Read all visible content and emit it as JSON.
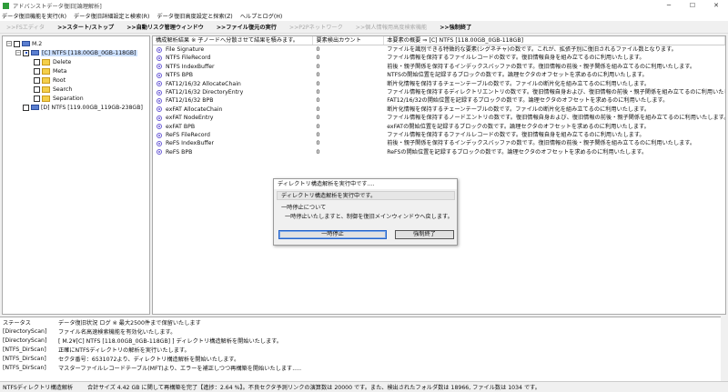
{
  "window": {
    "title": "アドバンストデータ復旧[論理解析]",
    "ctrl_min": "─",
    "ctrl_max": "☐",
    "ctrl_close": "✕"
  },
  "menu": [
    "データ復旧機能を実行(R)",
    "データ復旧詳細設定と検索(R)",
    "データ復旧高度設定と探索(Z)",
    "ヘルプとログ(H)"
  ],
  "toolbar": {
    "fs_editor": ">>FSエディタ",
    "start_stop": ">>スタート/ストップ",
    "auto_window": ">>自動リスク管理ウィンドウ",
    "file_restore": ">>ファイル復元の実行",
    "p2p": ">>P2Pネットワーク",
    "personal_info": ">>個人情報用高度検索機能",
    "force_quit": ">>強制終了"
  },
  "tree": {
    "root": "M.2",
    "drive_c": "[C] NTFS [118.00GB_0GB-118GB]",
    "folders": [
      "Delete",
      "Meta",
      "Root",
      "Search",
      "Separation"
    ],
    "drive_d": "[D] NTFS [119.00GB_119GB-238GB]",
    "expand_minus": "−"
  },
  "list": {
    "headers": [
      "構成解析結果 ※ 子ノードへ分散させて結果を積みます。",
      "要素検出カウント",
      "本要素の概要 ⇒ [C] NTFS [118.00GB_0GB-118GB]"
    ],
    "rows": [
      {
        "name": "File Signature",
        "count": "0",
        "desc": "ファイルを識別できる特徴的な要素(シグネチャ)の数です。これが、拡張子別に復旧されるファイル数となります。"
      },
      {
        "name": "NTFS FileRecord",
        "count": "0",
        "desc": "ファイル情報を保持するファイルレコードの数です。復旧情報自身を組み立てるのに利用いたします。"
      },
      {
        "name": "NTFS IndexBuffer",
        "count": "0",
        "desc": "前後・親子関係を保持するインデックスバッファの数です。復旧情報の前後・親子関係を組み立てるのに利用いたします。"
      },
      {
        "name": "NTFS BPB",
        "count": "0",
        "desc": "NTFSの開始位置を記録するブロックの数です。論理セクタのオフセットを求めるのに利用いたします。"
      },
      {
        "name": "FAT12/16/32 AllocateChain",
        "count": "0",
        "desc": "断片化情報を保持するチェーンテーブルの数です。ファイルの断片化を組み立てるのに利用いたします。"
      },
      {
        "name": "FAT12/16/32 DirectoryEntry",
        "count": "0",
        "desc": "ファイル情報を保持するディレクトリエントリの数です。復旧情報自身および、復旧情報の前後・親子関係を組み立てるのに利用いたします。"
      },
      {
        "name": "FAT12/16/32 BPB",
        "count": "0",
        "desc": "FAT12/16/32の開始位置を記録するブロックの数です。論理セクタのオフセットを求めるのに利用いたします。"
      },
      {
        "name": "exFAT AllocateChain",
        "count": "0",
        "desc": "断片化情報を保持するチェーンテーブルの数です。ファイルの断片化を組み立てるのに利用いたします。"
      },
      {
        "name": "exFAT NodeEntry",
        "count": "0",
        "desc": "ファイル情報を保持するノードエントリの数です。復旧情報自身および、復旧情報の前後・親子関係を組み立てるのに利用いたします。"
      },
      {
        "name": "exFAT BPB",
        "count": "0",
        "desc": "exFATの開始位置を記録するブロックの数です。論理セクタのオフセットを求めるのに利用いたします。"
      },
      {
        "name": "ReFS FileRecord",
        "count": "0",
        "desc": "ファイル情報を保持するファイルレコードの数です。復旧情報自身を組み立てるのに利用いたします。"
      },
      {
        "name": "ReFS IndexBuffer",
        "count": "0",
        "desc": "前後・親子関係を保持するインデックスバッファの数です。復旧情報の前後・親子関係を組み立てるのに利用いたします。"
      },
      {
        "name": "ReFS BPB",
        "count": "0",
        "desc": "ReFSの開始位置を記録するブロックの数です。論理セクタのオフセットを求めるのに利用いたします。"
      }
    ]
  },
  "dialog": {
    "title": "ディレクトリ構造解析を実行中です....",
    "message": "ディレクトリ構造解析を実行中です。",
    "line1": "一時停止について",
    "line2": "一時停止いたしますと、制御を復旧メインウィンドウへ戻します。",
    "pause_button": "一時停止",
    "force_button": "強制終了"
  },
  "log": {
    "header_col1": "ステータス",
    "header_col2": "データ復旧状況 ログ ※ 最大2500件まで保留いたします",
    "rows": [
      {
        "src": "[DirectoryScan]",
        "msg": "ファイル名高速検索機能を有効化いたします。"
      },
      {
        "src": "[DirectoryScan]",
        "msg": "[ M.2¥[C] NTFS [118.00GB_0GB-118GB] ] ディレクトリ構造解析を開始いたします。"
      },
      {
        "src": "[NTFS_DirScan]",
        "msg": "正確にNTFSディレクトリの解析を実行いたします。"
      },
      {
        "src": "[NTFS_DirScan]",
        "msg": "セクタ番号：6531072より、ディレクトリ構造解析を開始いたします。"
      },
      {
        "src": "[NTFS_DirScan]",
        "msg": "マスターファイルレコードテーブル(MFT)より、エラーを補正しつつ再構築を開始いたします....."
      }
    ]
  },
  "statusbar": {
    "left": "NTFSディレクトリ構造解析",
    "right": "合計サイズ 4.42 GB に関して再構築を完了【進捗：2.64 %】。不良セクタ予測リンクの演算数は 20000 です。また、検出されたフォルダ数は 18966, ファイル数は 1034 です。"
  }
}
